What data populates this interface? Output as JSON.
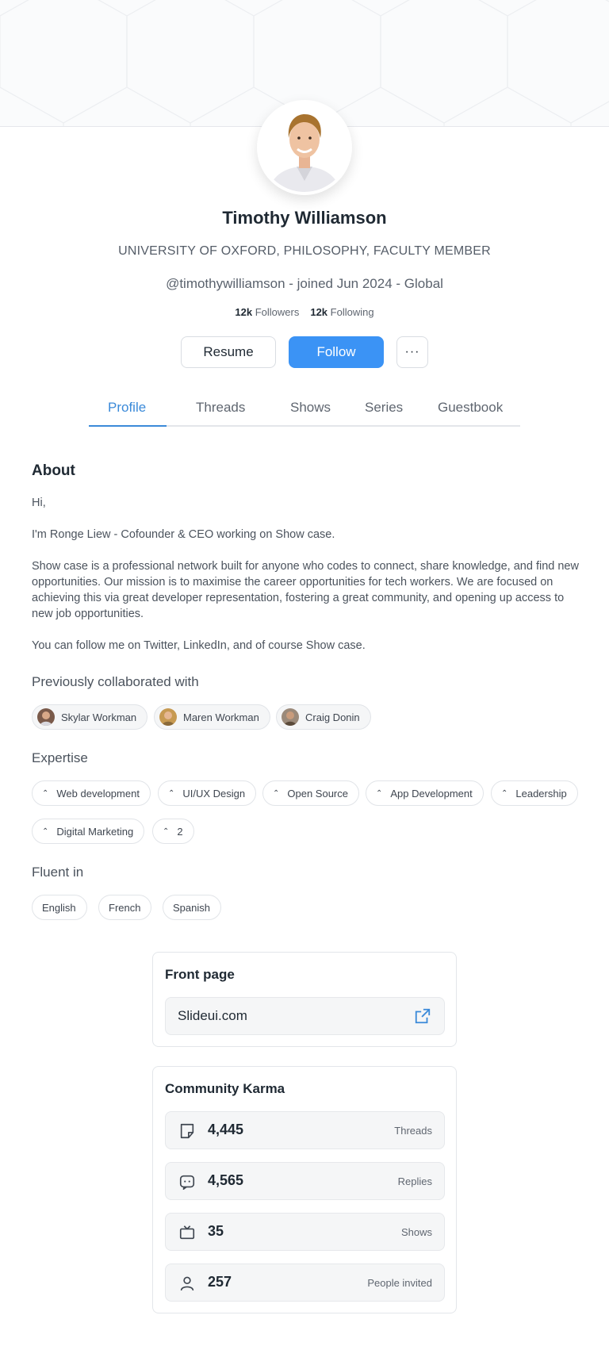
{
  "profile": {
    "name": "Timothy Williamson",
    "subtitle": "UNIVERSITY OF OXFORD, PHILOSOPHY, FACULTY MEMBER",
    "handle_line": "@timothywilliamson - joined Jun 2024 - Global",
    "followers_count": "12k",
    "followers_label": "Followers",
    "following_count": "12k",
    "following_label": "Following"
  },
  "actions": {
    "resume_label": "Resume",
    "follow_label": "Follow",
    "more_label": "···"
  },
  "tabs": [
    {
      "label": "Profile",
      "active": true
    },
    {
      "label": "Threads",
      "active": false
    },
    {
      "label": "Shows",
      "active": false
    },
    {
      "label": "Series",
      "active": false
    },
    {
      "label": "Guestbook",
      "active": false
    }
  ],
  "about": {
    "title": "About",
    "p1": "Hi,",
    "p2": "I'm Ronge Liew - Cofounder & CEO working on Show case.",
    "p3": "Show case is a professional network built for anyone who codes to connect, share knowledge, and find new opportunities. Our mission is to maximise the career opportunities for tech workers. We are focused on achieving this via great developer representation, fostering a great community, and opening up access to new job opportunities.",
    "p4": "You can follow me on Twitter, LinkedIn, and of course Show case."
  },
  "collaborated": {
    "title": "Previously collaborated with",
    "people": [
      "Skylar Workman",
      "Maren Workman",
      "Craig Donin"
    ]
  },
  "expertise": {
    "title": "Expertise",
    "items": [
      "Web development",
      "UI/UX Design",
      "Open Source",
      "App Development",
      "Leadership",
      "Digital Marketing",
      "2"
    ]
  },
  "fluent": {
    "title": "Fluent in",
    "languages": [
      "English",
      "French",
      "Spanish"
    ]
  },
  "front_page": {
    "title": "Front page",
    "link": "Slideui.com"
  },
  "karma": {
    "title": "Community Karma",
    "rows": [
      {
        "value": "4,445",
        "label": "Threads",
        "icon": "note-icon"
      },
      {
        "value": "4,565",
        "label": "Replies",
        "icon": "chat-icon"
      },
      {
        "value": "35",
        "label": "Shows",
        "icon": "tv-icon"
      },
      {
        "value": "257",
        "label": "People invited",
        "icon": "user-icon"
      }
    ]
  },
  "colors": {
    "accent": "#3b93f5",
    "tab_active": "#3b8ad9",
    "text": "#1f2933",
    "muted": "#5f6670"
  }
}
